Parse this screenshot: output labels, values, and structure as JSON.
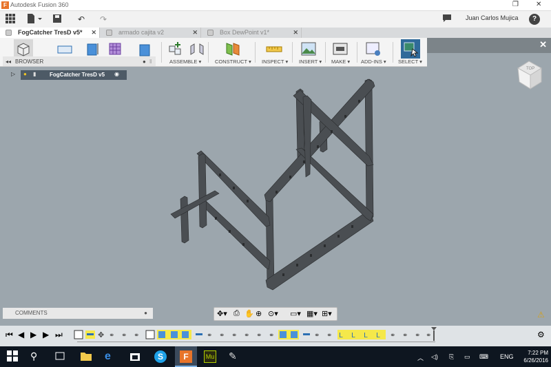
{
  "window": {
    "title": "Autodesk Fusion 360",
    "restore_glyph": "❐",
    "close_glyph": "✕",
    "logo_letter": "F"
  },
  "appbar": {
    "user_name": "Juan Carlos Mujica",
    "help_glyph": "?",
    "undo_glyph": "↶",
    "redo_glyph": "↷"
  },
  "tabs": [
    {
      "label": "FogCatcher TresD v5*",
      "active": true
    },
    {
      "label": "armado cajita v2",
      "active": false
    },
    {
      "label": "Box DewPoint v1*",
      "active": false
    }
  ],
  "toolbar": {
    "groups": [
      "ASSEMBLE ▾",
      "CONSTRUCT ▾",
      "INSPECT ▾",
      "INSERT ▾",
      "MAKE ▾",
      "ADD-INS ▾",
      "SELECT ▾"
    ]
  },
  "browser": {
    "label": "BROWSER",
    "component": "FogCatcher TresD v5"
  },
  "comments": {
    "label": "COMMENTS"
  },
  "viewcube": {
    "label": "TOP"
  },
  "clock": {
    "time": "7:22 PM",
    "date": "6/26/2016"
  },
  "tray": {
    "lang": "ENG"
  },
  "colors": {
    "accent": "#e8742a",
    "panel": "#f4f4f4",
    "viewport": "#9ca6ad",
    "model": "#4a4e52",
    "taskbar": "#0e1620"
  }
}
